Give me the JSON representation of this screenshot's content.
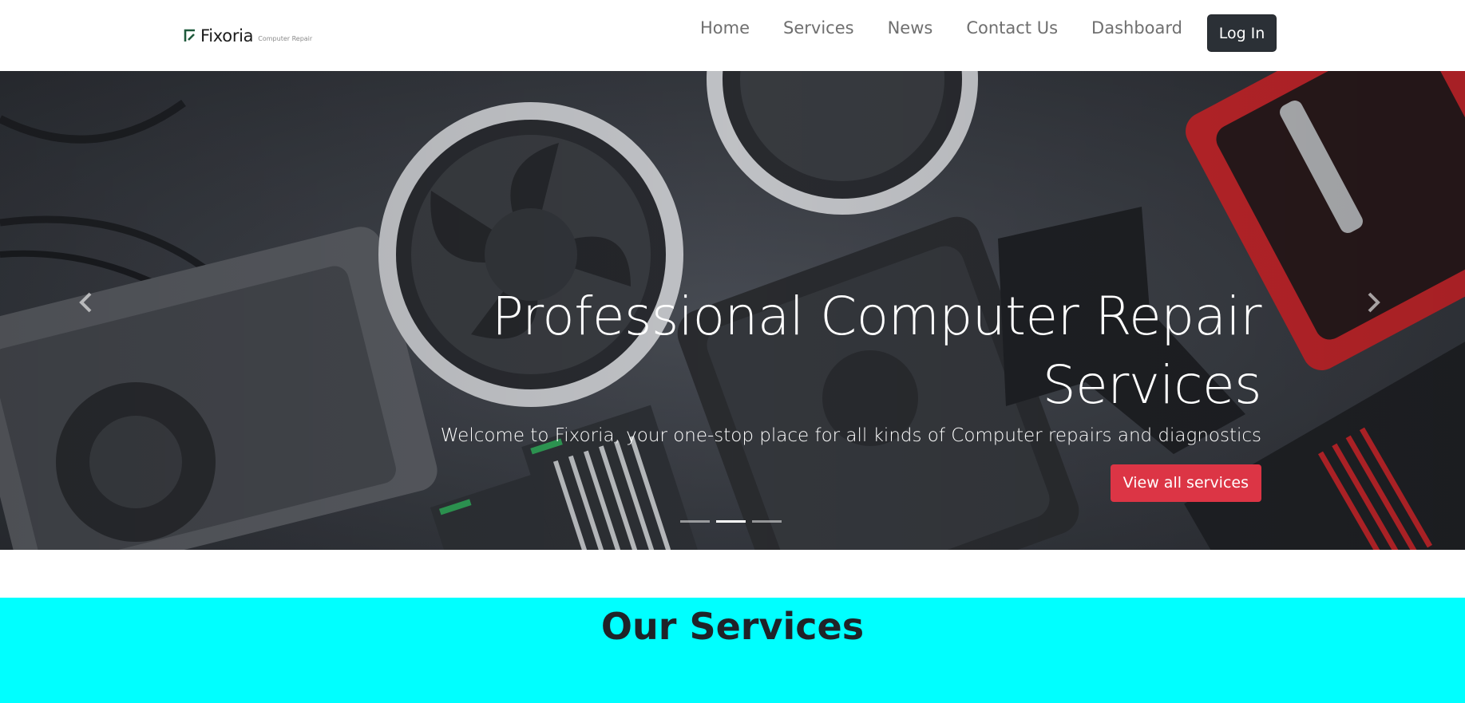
{
  "navbar": {
    "brand_name": "Fixoria",
    "brand_tagline": "Computer Repair",
    "links": [
      "Home",
      "Services",
      "News",
      "Contact Us",
      "Dashboard"
    ],
    "login_label": "Log In",
    "login_color": "#2b3036"
  },
  "hero": {
    "title": "Professional Computer Repair Services",
    "subtitle": "Welcome to Fixoria, your one-stop place for all kinds of Computer repairs and diagnostics",
    "cta_label": "View all services",
    "cta_color": "#dc3545",
    "prev_icon": "chevron-left-icon",
    "next_icon": "chevron-right-icon",
    "slide_count": 3,
    "active_slide": 2
  },
  "services": {
    "title": "Our Services",
    "background": "#00ffff"
  }
}
